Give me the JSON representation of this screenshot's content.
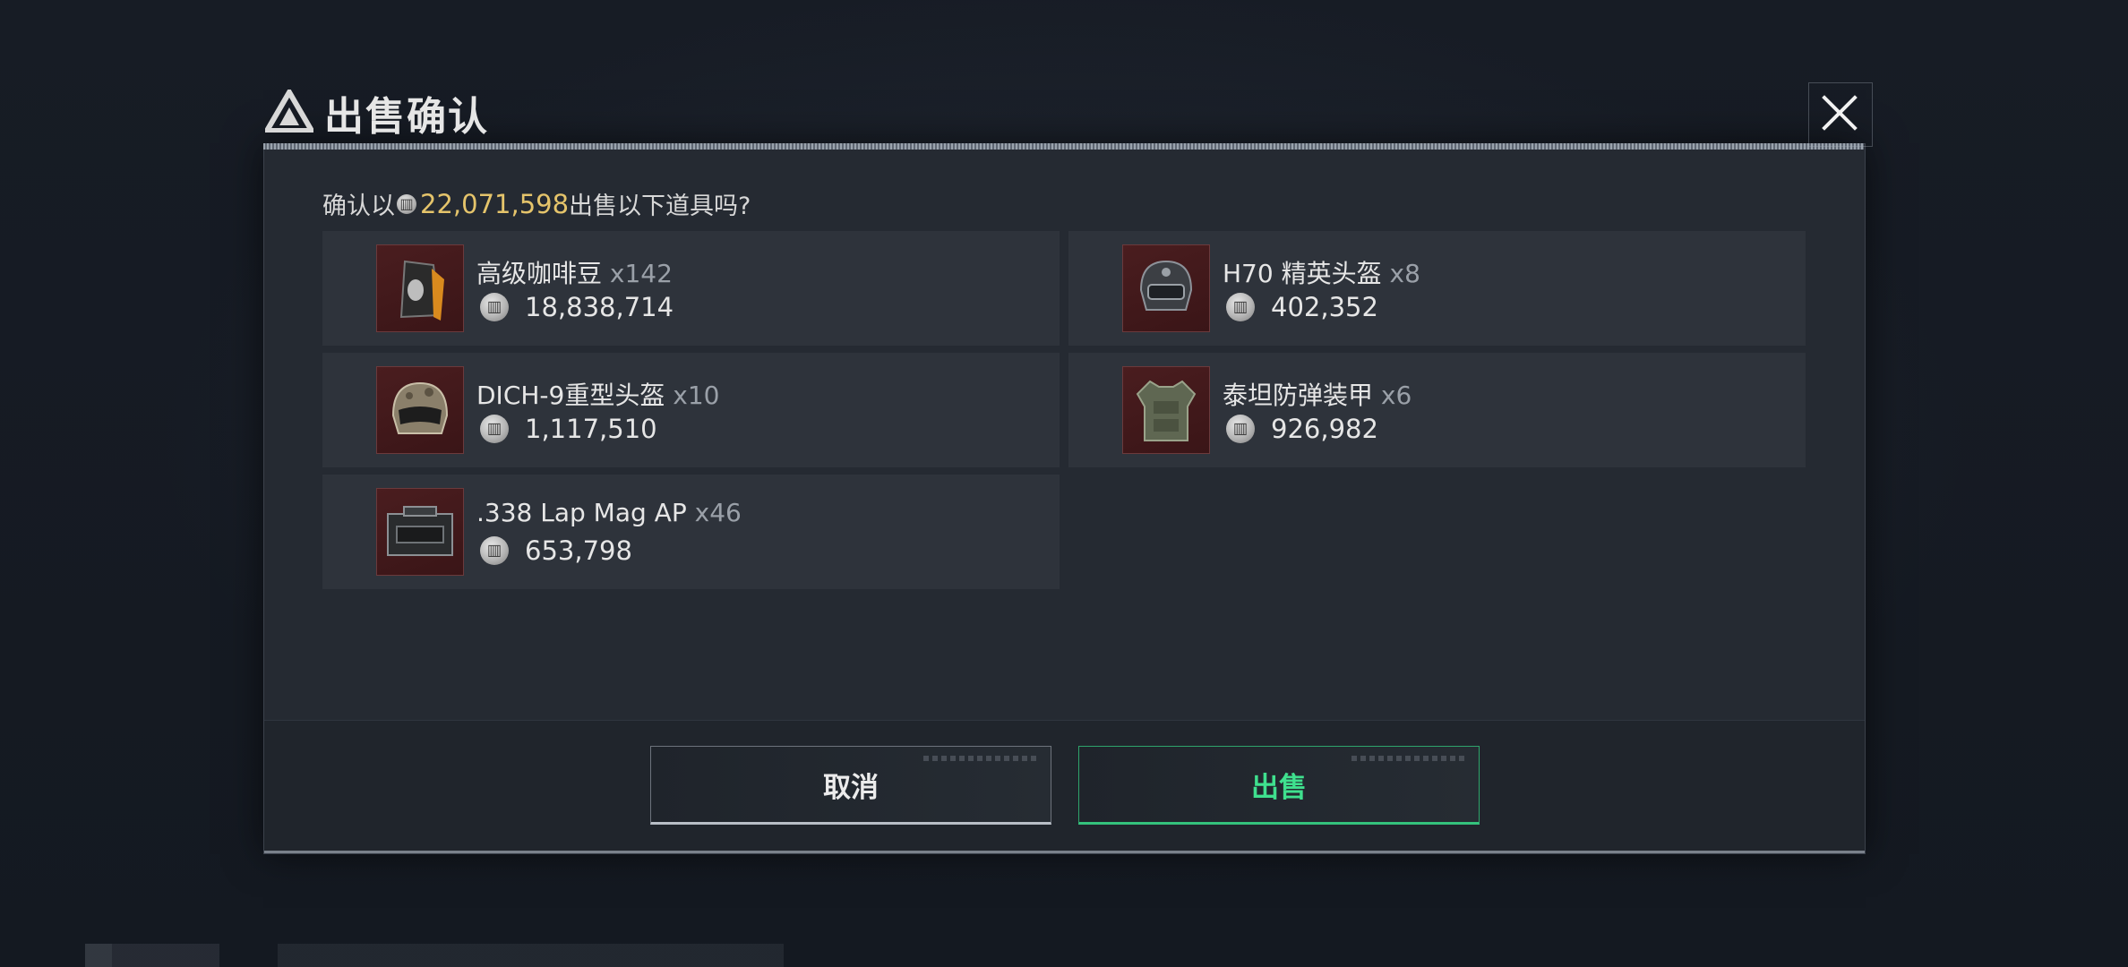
{
  "dialog": {
    "title": "出售确认",
    "close_icon": "close-icon",
    "prompt_prefix": "确认以",
    "prompt_amount": "22,071,598",
    "prompt_suffix": "出售以下道具吗?",
    "currency_icon": "coin-icon"
  },
  "items": [
    {
      "name": "高级咖啡豆",
      "qty": "x142",
      "price": "18,838,714",
      "icon": "coffee-beans-icon"
    },
    {
      "name": "H70 精英头盔",
      "qty": "x8",
      "price": "402,352",
      "icon": "helmet-icon"
    },
    {
      "name": "DICH-9重型头盔",
      "qty": "x10",
      "price": "1,117,510",
      "icon": "heavy-helmet-icon"
    },
    {
      "name": "泰坦防弹装甲",
      "qty": "x6",
      "price": "926,982",
      "icon": "body-armor-icon"
    },
    {
      "name": ".338 Lap Mag AP",
      "qty": "x46",
      "price": "653,798",
      "icon": "ammo-box-icon"
    }
  ],
  "buttons": {
    "cancel": "取消",
    "sell": "出售"
  },
  "colors": {
    "amount": "#e5c46b",
    "sell_accent": "#3fe08e",
    "thumb_bg": "#4a1d1f"
  }
}
